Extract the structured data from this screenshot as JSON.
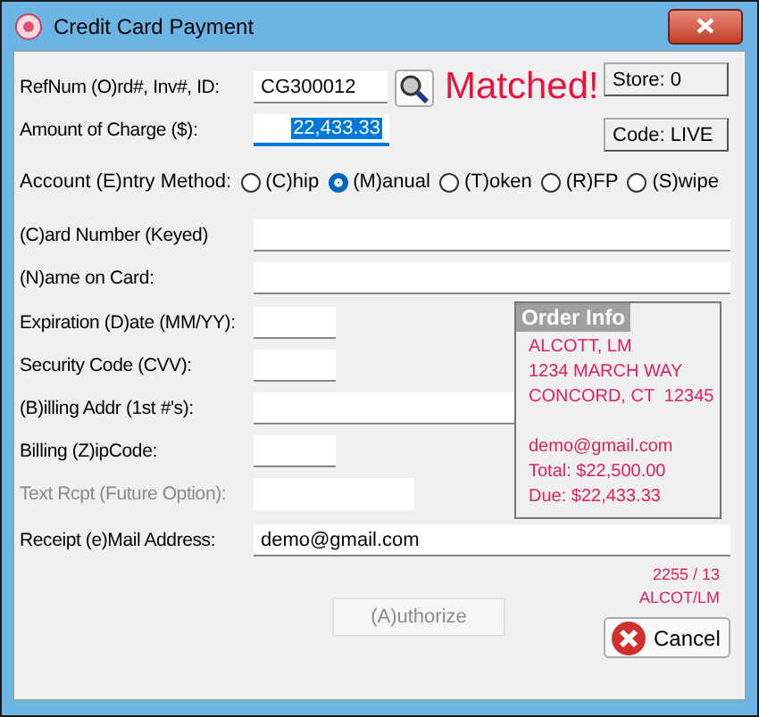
{
  "window": {
    "title": "Credit Card Payment"
  },
  "refnum": {
    "label": "RefNum (O)rd#, Inv#, ID:",
    "value": "CG300012",
    "status": "Matched!"
  },
  "amount": {
    "label": "Amount of Charge ($):",
    "value": "22,433.33",
    "selected": true
  },
  "side_buttons": [
    "Store: 0",
    "Code: LIVE"
  ],
  "entry_method": {
    "label": "Account (E)ntry Method:",
    "options": [
      {
        "label": "(C)hip",
        "selected": false
      },
      {
        "label": "(M)anual",
        "selected": true
      },
      {
        "label": "(T)oken",
        "selected": false
      },
      {
        "label": "(R)FP",
        "selected": false
      },
      {
        "label": "(S)wipe",
        "selected": false
      }
    ]
  },
  "wide_fields": [
    {
      "label": "(C)ard Number (Keyed)"
    },
    {
      "label": "(N)ame on Card:"
    }
  ],
  "fields": [
    {
      "label": "Expiration (D)ate (MM/YY):",
      "disabled": false
    },
    {
      "label": "Security Code (CVV):",
      "disabled": false
    },
    {
      "label": "(B)illing Addr (1st #'s):",
      "disabled": false
    },
    {
      "label": "Billing (Z)ipCode:",
      "disabled": false
    },
    {
      "label": "Text Rcpt (Future Option):",
      "disabled": true
    }
  ],
  "order_info": {
    "title": "Order Info",
    "address": [
      "ALCOTT, LM",
      "1234 MARCH WAY",
      "CONCORD, CT  12345"
    ],
    "details": [
      "demo@gmail.com",
      "Total: $22,500.00",
      "Due: $22,433.33"
    ]
  },
  "email": {
    "label": "Receipt (e)Mail Address:",
    "value": "demo@gmail.com"
  },
  "notes": [
    "2255 / 13",
    "ALCOT/LM"
  ],
  "authorize": {
    "label": "(A)uthorize",
    "disabled": true
  },
  "cancel": {
    "label": "Cancel"
  }
}
